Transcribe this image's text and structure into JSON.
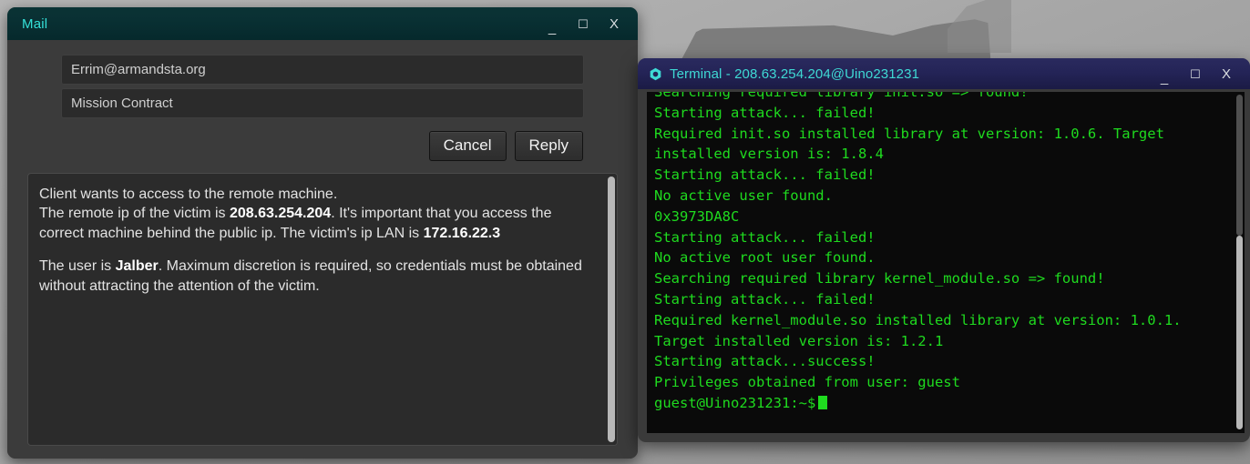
{
  "desktop": {
    "background_color": "#a4a4a4"
  },
  "mail_window": {
    "title": "Mail",
    "title_color": "#35e0d8",
    "titlebar_color": "#083033",
    "controls": {
      "minimize": "_",
      "maximize": "☐",
      "close": "X"
    },
    "fields": {
      "recipient_value": "Errim@armandsta.org",
      "recipient_placeholder": "Errim@armandsta.org",
      "subject_value": "Mission Contract",
      "subject_placeholder": "Mission Contract"
    },
    "buttons": {
      "cancel_label": "Cancel",
      "reply_label": "Reply"
    },
    "message": {
      "line1": "Client wants to access to the remote machine.",
      "line2_pre": "The remote ip of the victim is ",
      "remote_ip": "208.63.254.204",
      "line2_mid": ". It's important that you access the correct machine behind the public ip. The victim's ip LAN is ",
      "lan_ip": "172.16.22.3",
      "line3_pre": "The user is ",
      "user": "Jalber",
      "line3_post": ". Maximum discretion is required, so credentials must be obtained without attracting the attention of the victim."
    }
  },
  "terminal_window": {
    "title": "Terminal - 208.63.254.204@Uino231231",
    "title_color": "#3fd9d4",
    "titlebar_color": "#232356",
    "icon": "gear-hex-icon",
    "text_color": "#1fdb1f",
    "background_color": "#0a0a0a",
    "controls": {
      "minimize": "_",
      "maximize": "☐",
      "close": "X"
    },
    "lines": [
      "Searching required library init.so => found!",
      "Starting attack... failed!",
      "Required init.so installed library at version: 1.0.6. Target",
      "installed version is: 1.8.4",
      "Starting attack... failed!",
      "No active user found.",
      "0x3973DA8C",
      "Starting attack... failed!",
      "No active root user found.",
      "Searching required library kernel_module.so => found!",
      "Starting attack... failed!",
      "Required kernel_module.so installed library at version: 1.0.1.",
      "Target installed version is: 1.2.1",
      "Starting attack...success!",
      "Privileges obtained from user: guest"
    ],
    "prompt": "guest@Uino231231:~$"
  }
}
